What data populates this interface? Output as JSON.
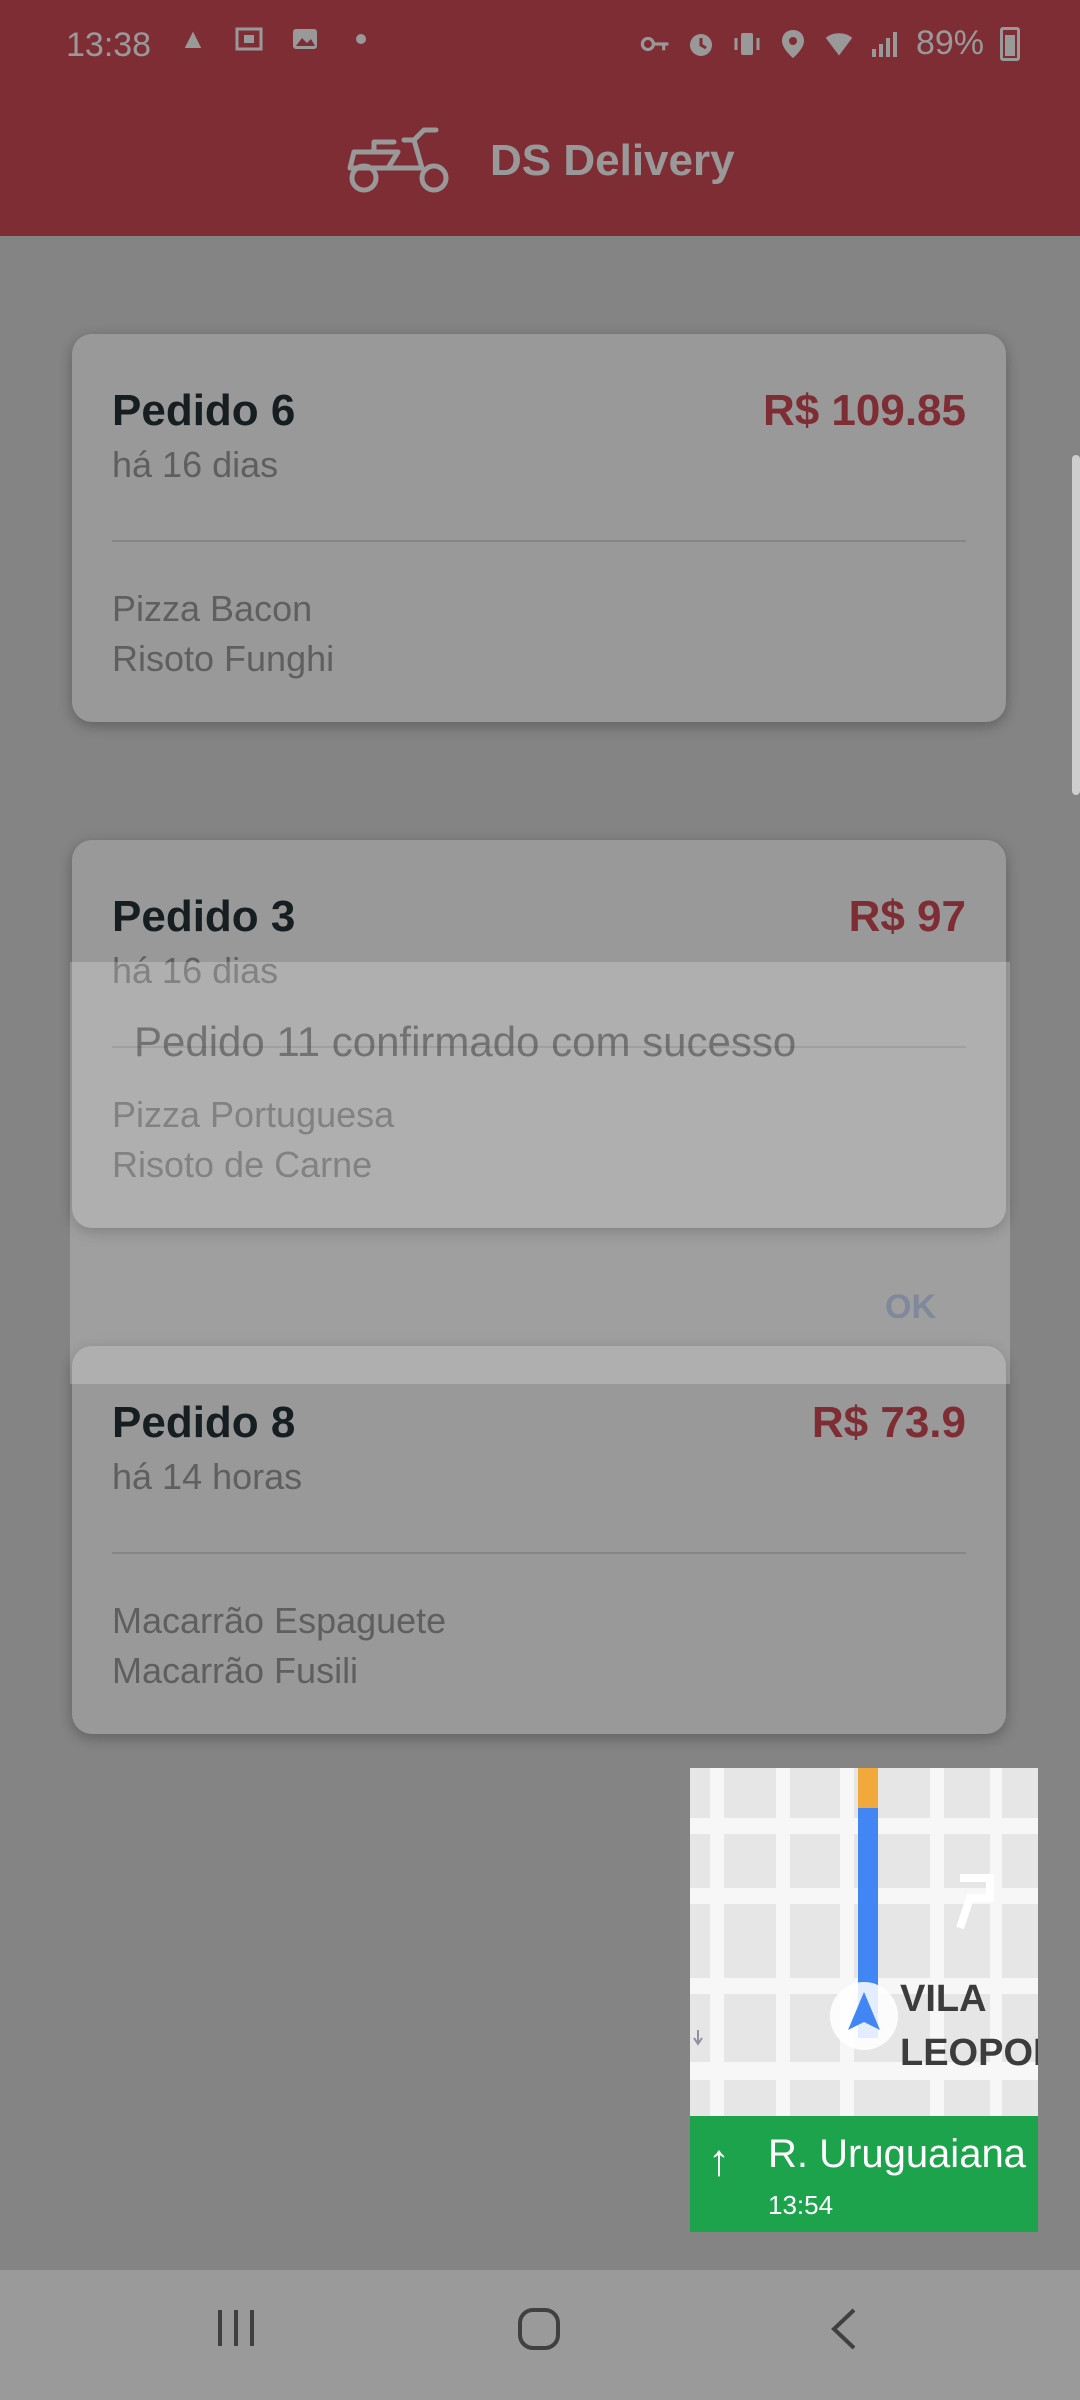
{
  "status_bar": {
    "time": "13:38",
    "battery": "89%",
    "left_icons": [
      "navigation-icon",
      "screenshot-icon",
      "photo-icon",
      "dot-icon"
    ],
    "right_icons": [
      "key-icon",
      "alarm-icon",
      "vibrate-icon",
      "location-icon",
      "wifi-icon",
      "signal-icon"
    ]
  },
  "header": {
    "title": "DS Delivery",
    "logo_icon": "scooter-icon"
  },
  "orders": [
    {
      "title": "Pedido 6",
      "price": "R$ 109.85",
      "time": "há 16 dias",
      "items": [
        "Pizza Bacon",
        "Risoto Funghi"
      ]
    },
    {
      "title": "Pedido 3",
      "price": "R$ 97",
      "time": "há 16 dias",
      "items": [
        "Pizza Portuguesa",
        "Risoto de Carne"
      ]
    },
    {
      "title": "Pedido 8",
      "price": "R$ 73.9",
      "time": "há 14 horas",
      "items": [
        "Macarrão Espaguete",
        "Macarrão Fusili"
      ]
    }
  ],
  "dialog": {
    "message": "Pedido 11 confirmado com sucesso",
    "ok_label": "OK"
  },
  "navigation_pip": {
    "area_line1": "VILA",
    "area_line2": "LEOPOLDI",
    "street": "R. Uruguaiana",
    "eta": "13:54",
    "direction_icon": "arrow-up-icon"
  },
  "system_nav": {
    "recents_icon": "recents-icon",
    "home_icon": "home-icon",
    "back_icon": "back-icon"
  },
  "colors": {
    "primary": "#d44b58",
    "nav_green": "#1ea34d",
    "title_text": "#263238"
  }
}
